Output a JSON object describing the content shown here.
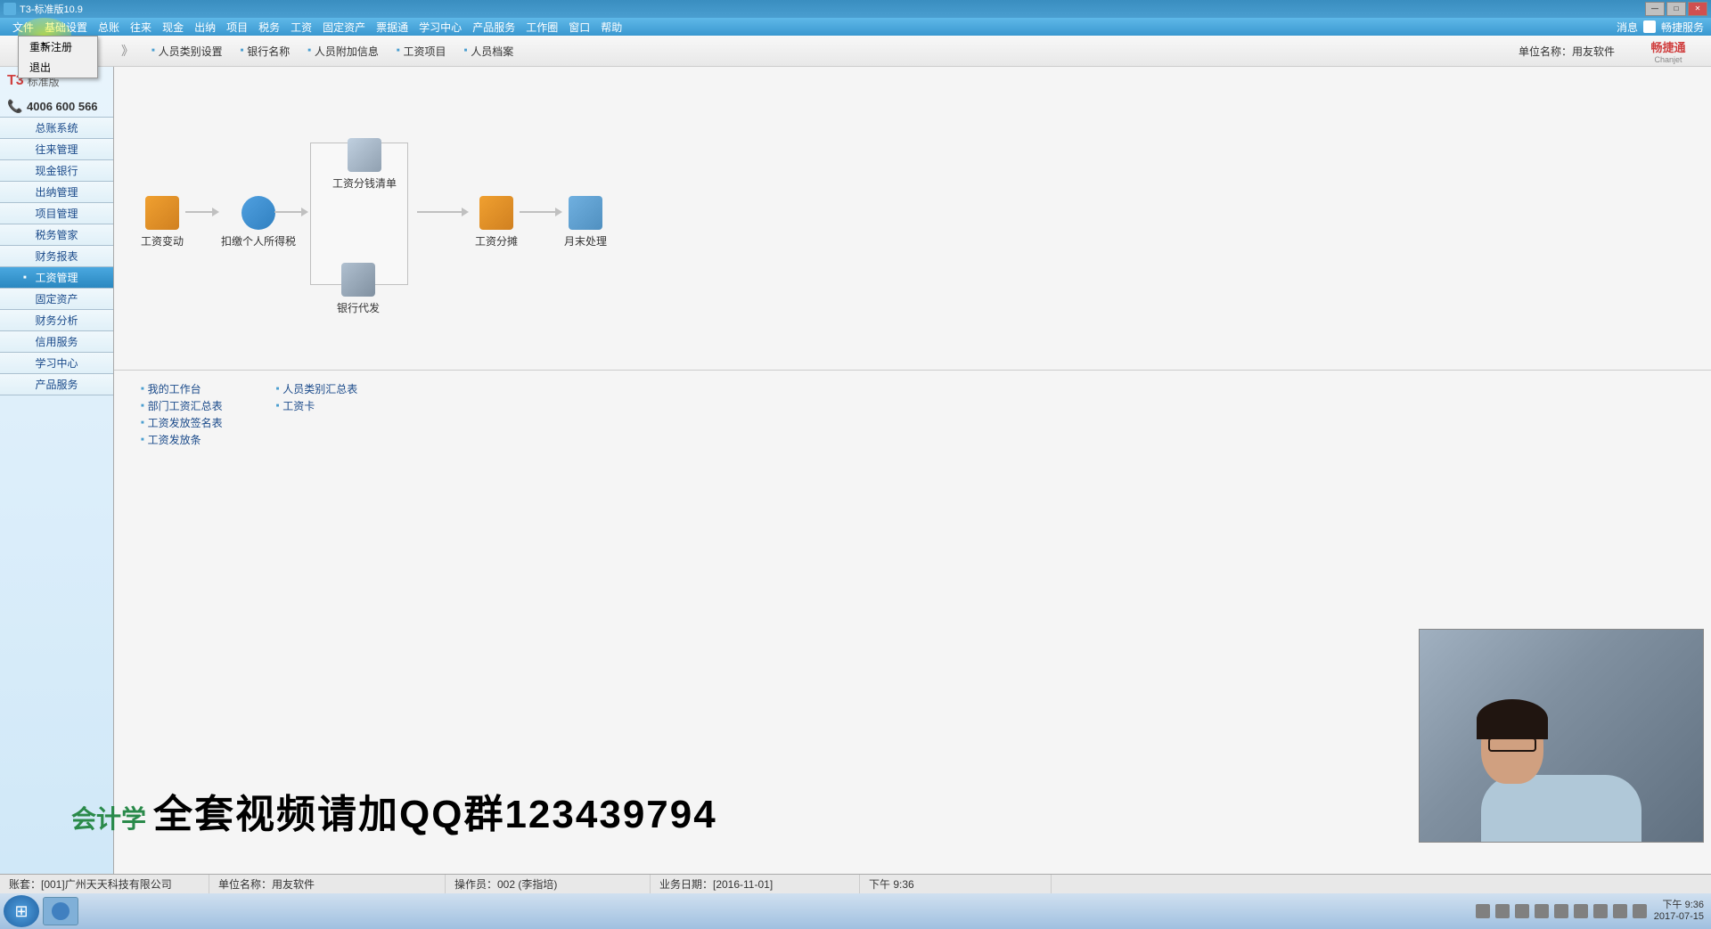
{
  "window": {
    "title": "T3-标准版10.9"
  },
  "menu": {
    "items": [
      "文件",
      "基础设置",
      "总账",
      "往来",
      "现金",
      "出纳",
      "项目",
      "税务",
      "工资",
      "固定资产",
      "票据通",
      "学习中心",
      "产品服务",
      "工作圈",
      "窗口",
      "帮助"
    ],
    "right": [
      "消息",
      "畅捷服务"
    ]
  },
  "dropdown": {
    "items": [
      "重新注册",
      "退出"
    ]
  },
  "secToolbar": {
    "tabs": [
      "人员类别设置",
      "银行名称",
      "人员附加信息",
      "工资项目",
      "人员档案"
    ],
    "unit": "单位名称：用友软件",
    "brand_cn": "畅捷通",
    "brand_en": "Chanjet"
  },
  "sidebar": {
    "logo_t3": "T3",
    "logo_text": "标准版",
    "phone": "4006 600 566",
    "nav": [
      "总账系统",
      "往来管理",
      "现金银行",
      "出纳管理",
      "项目管理",
      "税务管家",
      "财务报表",
      "工资管理",
      "固定资产",
      "财务分析",
      "信用服务",
      "学习中心",
      "产品服务"
    ],
    "activeIndex": 7
  },
  "workflow": {
    "nodes": {
      "gzbd": "工资变动",
      "kcgrsds": "扣缴个人所得税",
      "gzfqqd": "工资分钱清单",
      "yhdf": "银行代发",
      "gzft": "工资分摊",
      "ymcl": "月末处理"
    }
  },
  "bottomLinks": {
    "col1": [
      "我的工作台",
      "部门工资汇总表",
      "工资发放签名表",
      "工资发放条"
    ],
    "col2": [
      "人员类别汇总表",
      "工资卡"
    ]
  },
  "watermark": {
    "logo": "会计学",
    "text": "全套视频请加QQ群123439794"
  },
  "statusBar": {
    "account": "账套：[001]广州天天科技有限公司",
    "unit": "单位名称：用友软件",
    "operator": "操作员：002 (李指培)",
    "bizDate": "业务日期：[2016-11-01]",
    "time": "下午  9:36"
  },
  "taskbar": {
    "time": "下午 9:36",
    "date": "2017-07-15"
  }
}
